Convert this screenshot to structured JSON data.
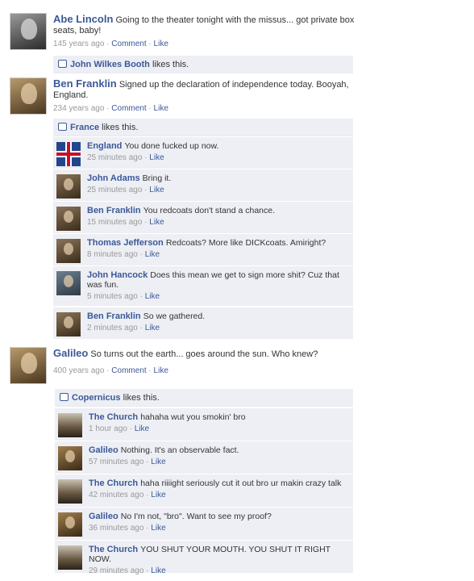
{
  "posts": [
    {
      "author": "Abe Lincoln",
      "message": "Going to the theater tonight with the missus... got private box seats, baby!",
      "age": "145 years ago",
      "comment_label": "Comment",
      "like_label": "Like",
      "likers": "John Wilkes Booth",
      "likes_suffix": "likes this.",
      "comments": []
    },
    {
      "author": "Ben Franklin",
      "message": "Signed up the declaration of independence today.  Booyah, England.",
      "age": "234 years ago",
      "comment_label": "Comment",
      "like_label": "Like",
      "likers": "France",
      "likes_suffix": "likes this.",
      "comments": [
        {
          "author": "England",
          "text": "You done fucked up now.",
          "age": "25 minutes ago",
          "like": "Like"
        },
        {
          "author": "John Adams",
          "text": "Bring it.",
          "age": "25 minutes ago",
          "like": "Like"
        },
        {
          "author": "Ben Franklin",
          "text": "You redcoats don't stand a chance.",
          "age": "15 minutes ago",
          "like": "Like"
        },
        {
          "author": "Thomas Jefferson",
          "text": "Redcoats?  More like DICKcoats.  Amiright?",
          "age": "8 minutes ago",
          "like": "Like"
        },
        {
          "author": "John Hancock",
          "text": "Does this mean we get to sign more shit?  Cuz that was fun.",
          "age": "5 minutes ago",
          "like": "Like"
        },
        {
          "author": "Ben Franklin",
          "text": "So we gathered.",
          "age": "2 minutes ago",
          "like": "Like"
        }
      ]
    },
    {
      "author": "Galileo",
      "message": "So turns out the earth... goes around the sun.  Who knew?",
      "age": "400 years ago",
      "comment_label": "Comment",
      "like_label": "Like",
      "likers": "Copernicus",
      "likes_suffix": "likes this.",
      "comments": [
        {
          "author": "The Church",
          "text": "hahaha wut you smokin' bro",
          "age": "1 hour ago",
          "like": "Like"
        },
        {
          "author": "Galileo",
          "text": "Nothing.  It's an observable fact.",
          "age": "57 minutes ago",
          "like": "Like"
        },
        {
          "author": "The Church",
          "text": "haha riiiight seriously cut it out bro ur makin crazy talk",
          "age": "42 minutes ago",
          "like": "Like"
        },
        {
          "author": "Galileo",
          "text": "No I'm not, \"bro\".  Want to see my proof?",
          "age": "36 minutes ago",
          "like": "Like"
        },
        {
          "author": "The Church",
          "text": "YOU SHUT YOUR MOUTH.  YOU SHUT IT RIGHT NOW.",
          "age": "29 minutes ago",
          "like": "Like"
        }
      ]
    }
  ],
  "separator": " · "
}
